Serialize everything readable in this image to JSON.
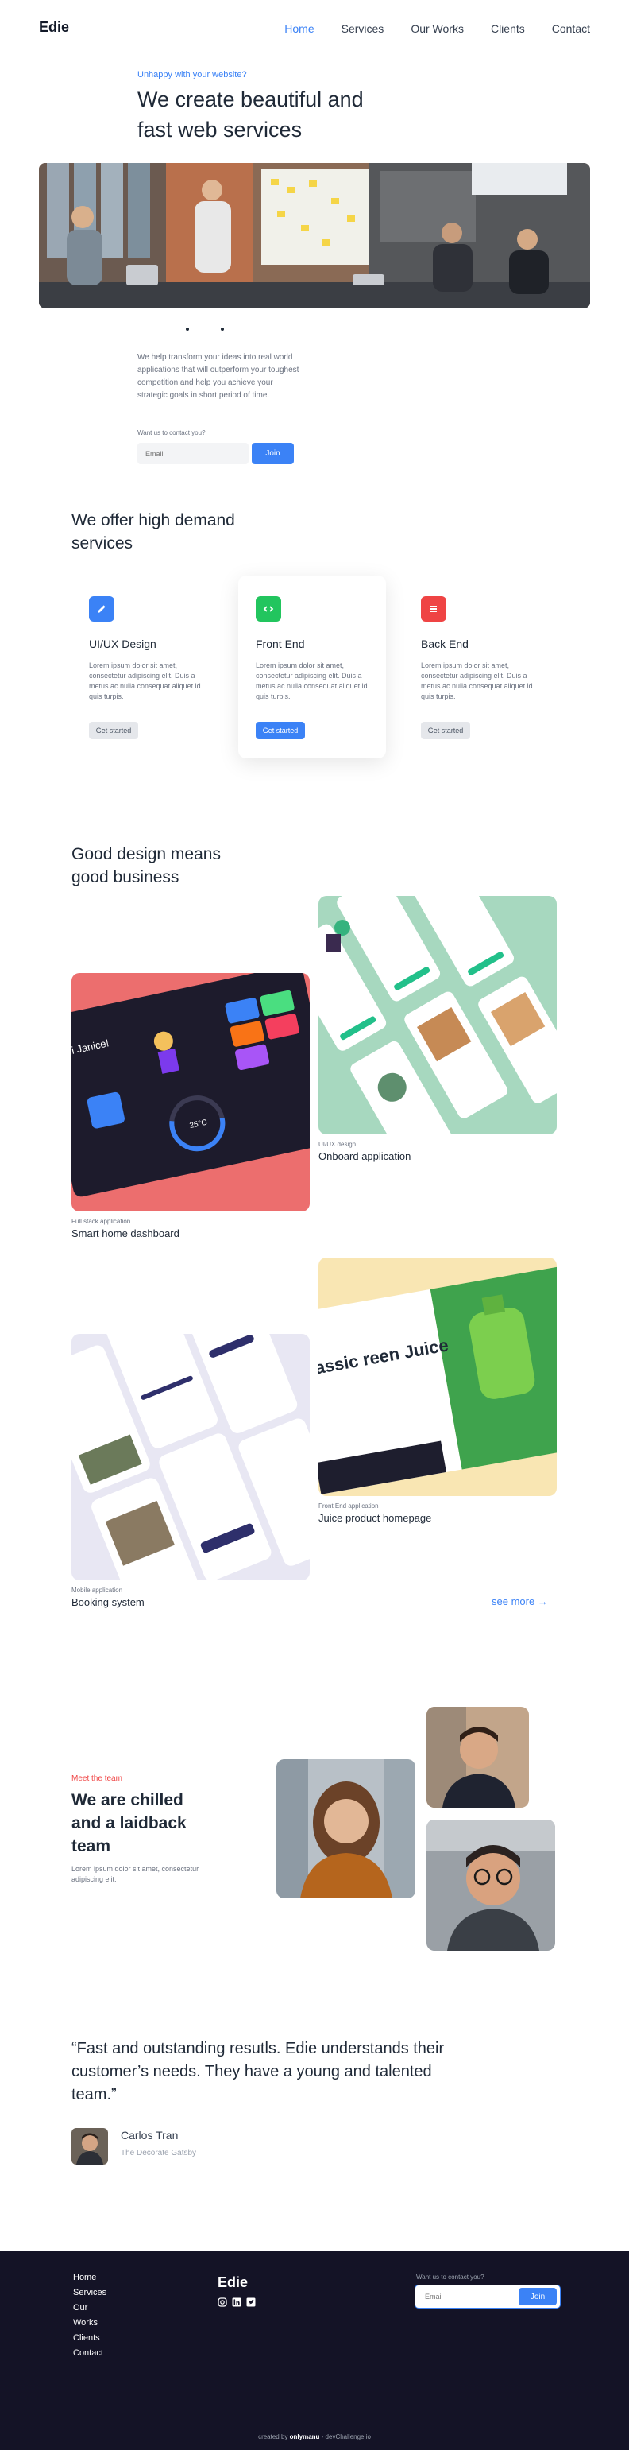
{
  "header": {
    "logo": "Edie",
    "nav": [
      "Home",
      "Services",
      "Our Works",
      "Clients",
      "Contact"
    ]
  },
  "hero": {
    "eyebrow": "Unhappy with your website?",
    "title": "We create beautiful and fast web services",
    "description": "We help transform your ideas into real world applications that will outperform your toughest competition and help you achieve your strategic goals in short period of time.",
    "contact_label": "Want us to contact you?",
    "email_placeholder": "Email",
    "join_label": "Join"
  },
  "services": {
    "title": "We offer high demand services",
    "cards": [
      {
        "title": "UI/UX Design",
        "text": "Lorem ipsum dolor sit amet, consectetur adipiscing elit. Duis a metus ac nulla consequat aliquet id quis turpis.",
        "button": "Get started",
        "icon": "pencil-icon",
        "color": "#3b82f6"
      },
      {
        "title": "Front End",
        "text": "Lorem ipsum dolor sit amet, consectetur adipiscing elit. Duis a metus ac nulla consequat aliquet id quis turpis.",
        "button": "Get started",
        "icon": "code-icon",
        "color": "#22c55e"
      },
      {
        "title": "Back End",
        "text": "Lorem ipsum dolor sit amet, consectetur adipiscing elit. Duis a metus ac nulla consequat aliquet id quis turpis.",
        "button": "Get started",
        "icon": "server-icon",
        "color": "#ef4444"
      }
    ]
  },
  "portfolio": {
    "title": "Good design means good business",
    "projects": [
      {
        "category": "UI/UX design",
        "name": "Onboard application"
      },
      {
        "category": "Full stack application",
        "name": "Smart home dashboard"
      },
      {
        "category": "Front End application",
        "name": "Juice product homepage"
      },
      {
        "category": "Mobile application",
        "name": "Booking system"
      }
    ],
    "dashboard_greeting": "Hi Janice!",
    "dashboard_temp": "25°C",
    "juice_heading": "assic reen Juice",
    "see_more": "see more"
  },
  "team": {
    "eyebrow": "Meet the team",
    "title": "We are chilled and a laidback team",
    "text": "Lorem ipsum dolor sit amet, consectetur adipiscing elit."
  },
  "testimonial": {
    "quote": "“Fast and outstanding resutls. Edie understands their customer’s needs. They have a young and talented team.”",
    "name": "Carlos Tran",
    "company": "The Decorate Gatsby"
  },
  "footer": {
    "links": [
      "Home",
      "Services",
      "Our",
      "Works",
      "Clients",
      "Contact"
    ],
    "logo": "Edie",
    "contact_label": "Want us to contact you?",
    "email_placeholder": "Email",
    "join_label": "Join",
    "credit_prefix": "created by",
    "credit_author": "onlymanu",
    "credit_suffix": "- devChallenge.io",
    "social": [
      "instagram-icon",
      "linkedin-icon",
      "twitter-icon"
    ]
  },
  "colors": {
    "accent": "#3b82f6",
    "red": "#ef4444",
    "green": "#22c55e",
    "footer_bg": "#141326"
  }
}
